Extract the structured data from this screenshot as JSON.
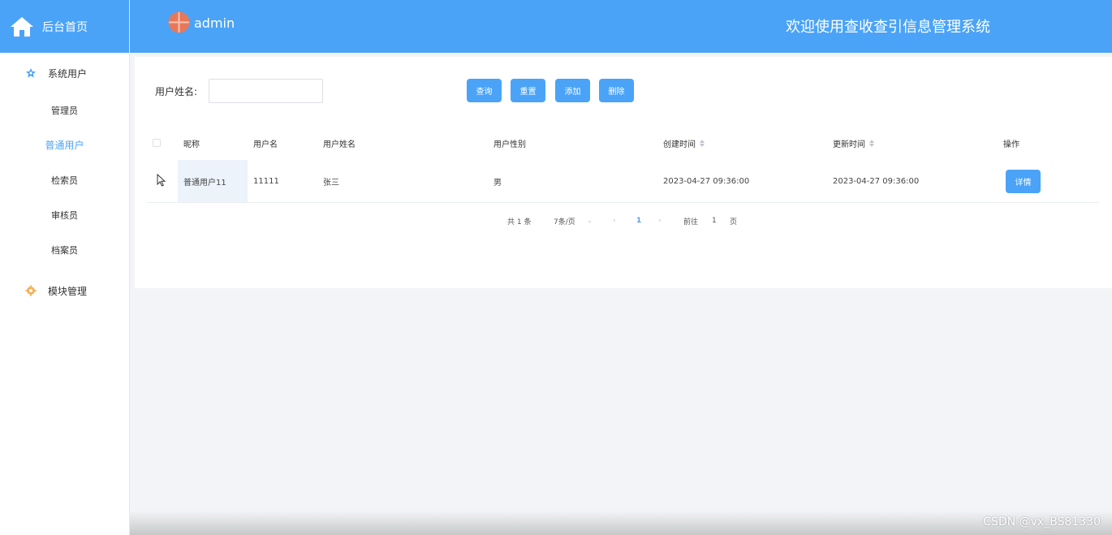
{
  "sidebar": {
    "home_label": "后台首页",
    "groups": [
      {
        "label": "系统用户",
        "items": [
          "管理员",
          "普通用户",
          "检索员",
          "审核员",
          "档案员"
        ]
      },
      {
        "label": "模块管理"
      }
    ],
    "active_item": "普通用户",
    "accent": "#4aa3f7"
  },
  "header": {
    "username": "admin",
    "welcome": "欢迎使用查收查引信息管理系统",
    "background": "#4aa3f7"
  },
  "search": {
    "label": "用户姓名:",
    "value": "",
    "placeholder": ""
  },
  "toolbar": {
    "query": "查询",
    "reset": "重置",
    "add": "添加",
    "delete": "删除"
  },
  "table": {
    "columns": [
      "昵称",
      "用户名",
      "用户姓名",
      "用户性别",
      "创建时间",
      "更新时间",
      "操作"
    ],
    "rows": [
      {
        "nickname": "普通用户11",
        "username": "11111",
        "realname": "张三",
        "gender": "男",
        "created": "2023-04-27 09:36:00",
        "updated": "2023-04-27 09:36:00",
        "action": "详情"
      }
    ]
  },
  "pagination": {
    "total": "共 1 条",
    "page_size": "7条/页",
    "current_page": "1",
    "goto_prefix": "前往",
    "goto_value": "1",
    "goto_suffix": "页"
  },
  "watermark": "CSDN @vx_BS81330"
}
